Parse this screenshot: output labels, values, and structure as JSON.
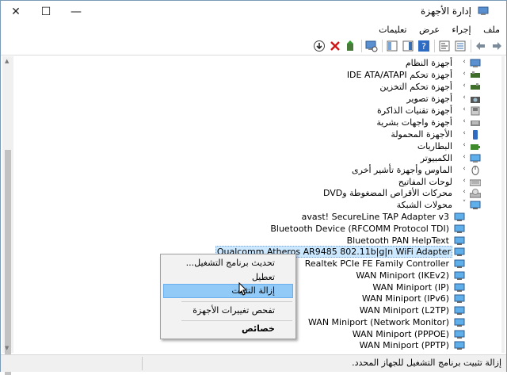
{
  "window": {
    "title": "إدارة الأجهزة",
    "minimize": "—",
    "maximize": "☐",
    "close": "✕"
  },
  "menu": [
    "ملف",
    "إجراء",
    "عرض",
    "تعليمات"
  ],
  "tree": {
    "categories": [
      "أجهزة النظام",
      "أجهزة تحكم IDE ATA/ATAPI",
      "أجهزة تحكم التخزين",
      "أجهزة تصوير",
      "أجهزة تقنيات الذاكرة",
      "أجهزة واجهات بشرية",
      "الأجهزة المحمولة",
      "البطاريات",
      "الكمبيوتر",
      "الماوس وأجهزة تأشير أخرى",
      "لوحات المفاتيح",
      "محركات الأقراص المضغوطة وDVD",
      "محولات الشبكة"
    ],
    "network_adapters": [
      "avast! SecureLine TAP Adapter v3",
      "Bluetooth Device (RFCOMM Protocol TDI)",
      "Bluetooth PAN HelpText",
      "Qualcomm Atheros AR9485 802.11b|g|n WiFi Adapter",
      "Realtek PCIe FE Family Controller",
      "WAN Miniport (IKEv2)",
      "WAN Miniport (IP)",
      "WAN Miniport (IPv6)",
      "WAN Miniport (L2TP)",
      "WAN Miniport (Network Monitor)",
      "WAN Miniport (PPPOE)",
      "WAN Miniport (PPTP)"
    ]
  },
  "context_menu": {
    "update_driver": "تحديث برنامج التشغيل...",
    "disable": "تعطيل",
    "uninstall": "إزالة التثبيت",
    "scan": "تفحص تغييرات الأجهزة",
    "properties": "خصائص"
  },
  "status": {
    "text": "إزالة تثبيت برنامج التشغيل للجهاز المحدد."
  },
  "colors": {
    "selection": "#cce8ff",
    "menu_highlight": "#91c9f7"
  }
}
